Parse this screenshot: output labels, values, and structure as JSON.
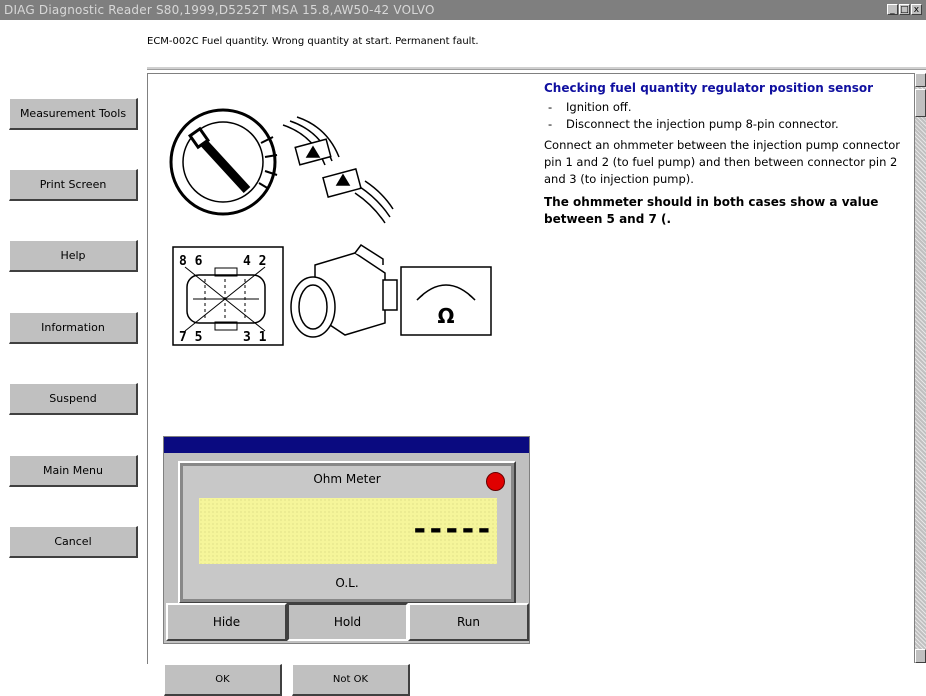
{
  "window": {
    "title": "DIAG Diagnostic Reader S80,1999,D5252T MSA 15.8,AW50-42 VOLVO",
    "controls": [
      "_",
      "□",
      "x"
    ]
  },
  "status_message": "ECM-002C Fuel quantity. Wrong quantity at start. Permanent fault.",
  "sidebar": {
    "buttons": [
      {
        "label": "Measurement Tools"
      },
      {
        "label": "Print Screen"
      },
      {
        "label": "Help"
      },
      {
        "label": "Information"
      },
      {
        "label": "Suspend"
      },
      {
        "label": "Main Menu"
      },
      {
        "label": "Cancel"
      }
    ]
  },
  "diagram": {
    "pin_top": "8 6",
    "pin_top_right": "4 2",
    "pin_bottom": "7 5",
    "pin_bottom_right": "3 1",
    "ohm_symbol": "Ω"
  },
  "instructions": {
    "heading": "Checking fuel quantity regulator position sensor",
    "steps": [
      "Ignition off.",
      "Disconnect the injection pump 8-pin connector."
    ],
    "para": "Connect an ohmmeter between the injection pump connector pin 1 and 2 (to fuel pump) and then between connector pin 2 and 3 (to injection pump).",
    "expected": "The ohmmeter should in both cases show a value between 5 and 7 (."
  },
  "ohm_meter": {
    "title": "Ohm Meter",
    "reading": "-----",
    "unit": "O.L.",
    "buttons": [
      {
        "label": "Hide"
      },
      {
        "label": "Hold"
      },
      {
        "label": "Run"
      }
    ],
    "lamp_color": "#e00000"
  },
  "bottom_buttons": [
    {
      "label": "OK"
    },
    {
      "label": "Not OK"
    }
  ],
  "colors": {
    "title_bar": "#7f7f7f",
    "heading": "#1010a0",
    "meter_bar": "#0a0a80",
    "display": "#f5f59a"
  }
}
